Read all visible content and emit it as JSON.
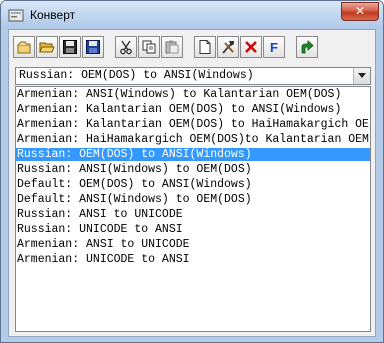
{
  "window": {
    "title": "Конверт",
    "close_glyph": "✕"
  },
  "toolbar": {
    "buttons": [
      {
        "name": "new-icon"
      },
      {
        "name": "open-folder-icon"
      },
      {
        "name": "save-icon"
      },
      {
        "name": "save-as-icon"
      },
      {
        "name": "cut-icon"
      },
      {
        "name": "copy-icon"
      },
      {
        "name": "paste-icon"
      },
      {
        "name": "new-document-icon"
      },
      {
        "name": "tools-icon"
      },
      {
        "name": "delete-icon"
      },
      {
        "name": "font-icon",
        "label": "F"
      },
      {
        "name": "apply-icon"
      }
    ]
  },
  "combo": {
    "selected": "Russian: OEM(DOS) to ANSI(Windows)"
  },
  "list": {
    "items": [
      "Armenian: ANSI(Windows) to Kalantarian OEM(DOS)",
      "Armenian: Kalantarian OEM(DOS) to ANSI(Windows)",
      "Armenian: Kalantarian OEM(DOS) to HaiHamakargich OE",
      "Armenian: HaiHamakargich OEM(DOS)to Kalantarian OEM",
      "Russian: OEM(DOS) to ANSI(Windows)",
      "Russian: ANSI(Windows) to OEM(DOS)",
      "Default: OEM(DOS) to ANSI(Windows)",
      "Default: ANSI(Windows) to OEM(DOS)",
      "Russian: ANSI to UNICODE",
      "Russian: UNICODE to ANSI",
      "Armenian: ANSI to UNICODE",
      "Armenian: UNICODE to ANSI"
    ],
    "selected_index": 4
  },
  "colors": {
    "selection": "#3399ff",
    "close_button": "#c23a22",
    "delete_red": "#d40000",
    "font_blue": "#1a3fd0"
  }
}
